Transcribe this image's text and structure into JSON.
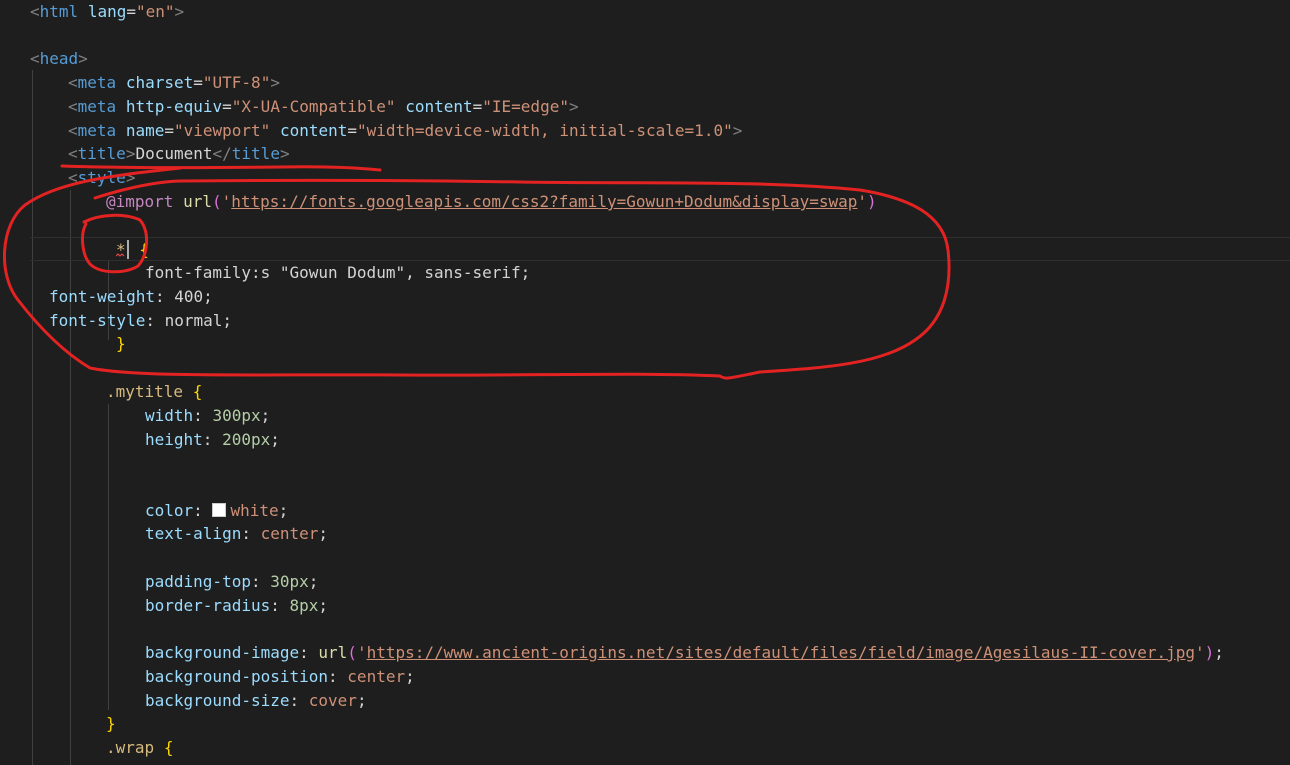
{
  "editor": {
    "theme": "dark",
    "accent": "#569cd6",
    "annotation_color": "#e32222",
    "lines": {
      "l1": {
        "open": "<",
        "tag": "html",
        "attr": "lang",
        "eq": "=",
        "value": "\"en\"",
        "close": ">"
      },
      "l3": {
        "open": "<",
        "tag": "head",
        "close": ">"
      },
      "l4": {
        "open": "<",
        "tag": "meta",
        "attr": "charset",
        "eq": "=",
        "value": "\"UTF-8\"",
        "close": ">"
      },
      "l5": {
        "open": "<",
        "tag": "meta",
        "attr1": "http-equiv",
        "eq1": "=",
        "value1": "\"X-UA-Compatible\"",
        "attr2": "content",
        "eq2": "=",
        "value2": "\"IE=edge\"",
        "close": ">"
      },
      "l6": {
        "open": "<",
        "tag": "meta",
        "attr1": "name",
        "eq1": "=",
        "value1": "\"viewport\"",
        "attr2": "content",
        "eq2": "=",
        "value2": "\"width=device-width, initial-scale=1.0\"",
        "close": ">"
      },
      "l7": {
        "open": "<",
        "tag": "title",
        "close": ">",
        "text": "Document",
        "end_open": "</",
        "end_tag": "title",
        "end_close": ">"
      },
      "l8": {
        "open": "<",
        "tag": "style",
        "close": ">"
      },
      "l9": {
        "at": "@import",
        "fn": "url",
        "paren_open": "(",
        "quote_open": "'",
        "url": "https://fonts.googleapis.com/css2?family=Gowun+Dodum&display=swap",
        "quote_close": "'",
        "paren_close": ")"
      },
      "l10": {
        "selector": "*",
        "brace": "{"
      },
      "l11": {
        "text": "font-family:s \"Gowun Dodum\", sans-serif;"
      },
      "l12": {
        "prop": "font-weight",
        "colon": ": ",
        "value": "400",
        "semi": ";"
      },
      "l13": {
        "prop": "font-style",
        "colon": ": ",
        "value": "normal",
        "semi": ";"
      },
      "l14": {
        "brace": "}"
      },
      "l15": {
        "selector": ".mytitle",
        "brace": "{"
      },
      "l16": {
        "prop": "width",
        "colon": ": ",
        "value": "300px",
        "semi": ";"
      },
      "l17": {
        "prop": "height",
        "colon": ": ",
        "value": "200px",
        "semi": ";"
      },
      "l20": {
        "prop": "color",
        "colon": ": ",
        "value": "white",
        "semi": ";",
        "swatch_color": "#ffffff"
      },
      "l21": {
        "prop": "text-align",
        "colon": ": ",
        "value": "center",
        "semi": ";"
      },
      "l23": {
        "prop": "padding-top",
        "colon": ": ",
        "value": "30px",
        "semi": ";"
      },
      "l24": {
        "prop": "border-radius",
        "colon": ": ",
        "value": "8px",
        "semi": ";"
      },
      "l26": {
        "prop": "background-image",
        "colon": ": ",
        "fn": "url",
        "paren_open": "(",
        "quote_open": "'",
        "url": "https://www.ancient-origins.net/sites/default/files/field/image/Agesilaus-II-cover.jpg",
        "quote_close": "'",
        "paren_close": ")",
        "semi": ";"
      },
      "l27": {
        "prop": "background-position",
        "colon": ": ",
        "value": "center",
        "semi": ";"
      },
      "l28": {
        "prop": "background-size",
        "colon": ": ",
        "value": "cover",
        "semi": ";"
      },
      "l29": {
        "brace": "}"
      },
      "l30": {
        "selector": ".wrap",
        "brace": "{"
      }
    }
  }
}
